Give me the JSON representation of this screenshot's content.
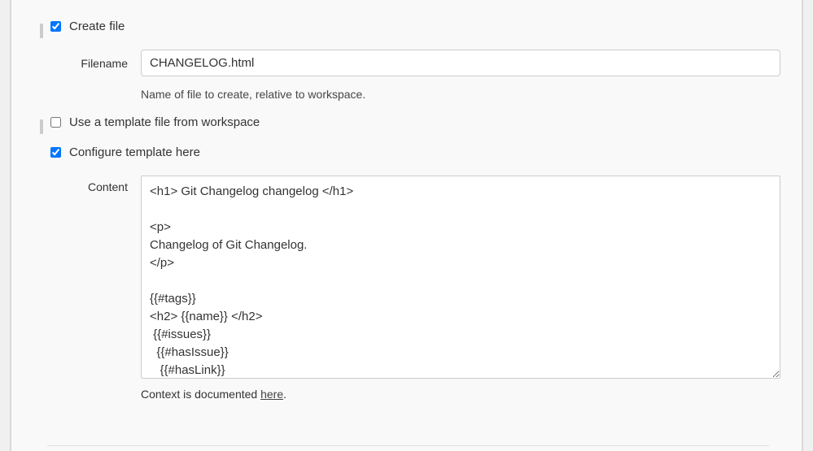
{
  "createFile": {
    "checked": true,
    "label": "Create file"
  },
  "filename": {
    "label": "Filename",
    "value": "CHANGELOG.html",
    "help": "Name of file to create, relative to workspace."
  },
  "useTemplateFile": {
    "checked": false,
    "label": "Use a template file from workspace"
  },
  "configureTemplate": {
    "checked": true,
    "label": "Configure template here"
  },
  "content": {
    "label": "Content",
    "value": "<h1> Git Changelog changelog </h1>\n\n<p>\nChangelog of Git Changelog.\n</p>\n\n{{#tags}}\n<h2> {{name}} </h2>\n {{#issues}}\n  {{#hasIssue}}\n   {{#hasLink}}",
    "docText": "Context is documented ",
    "docLinkText": "here",
    "docSuffix": "."
  }
}
